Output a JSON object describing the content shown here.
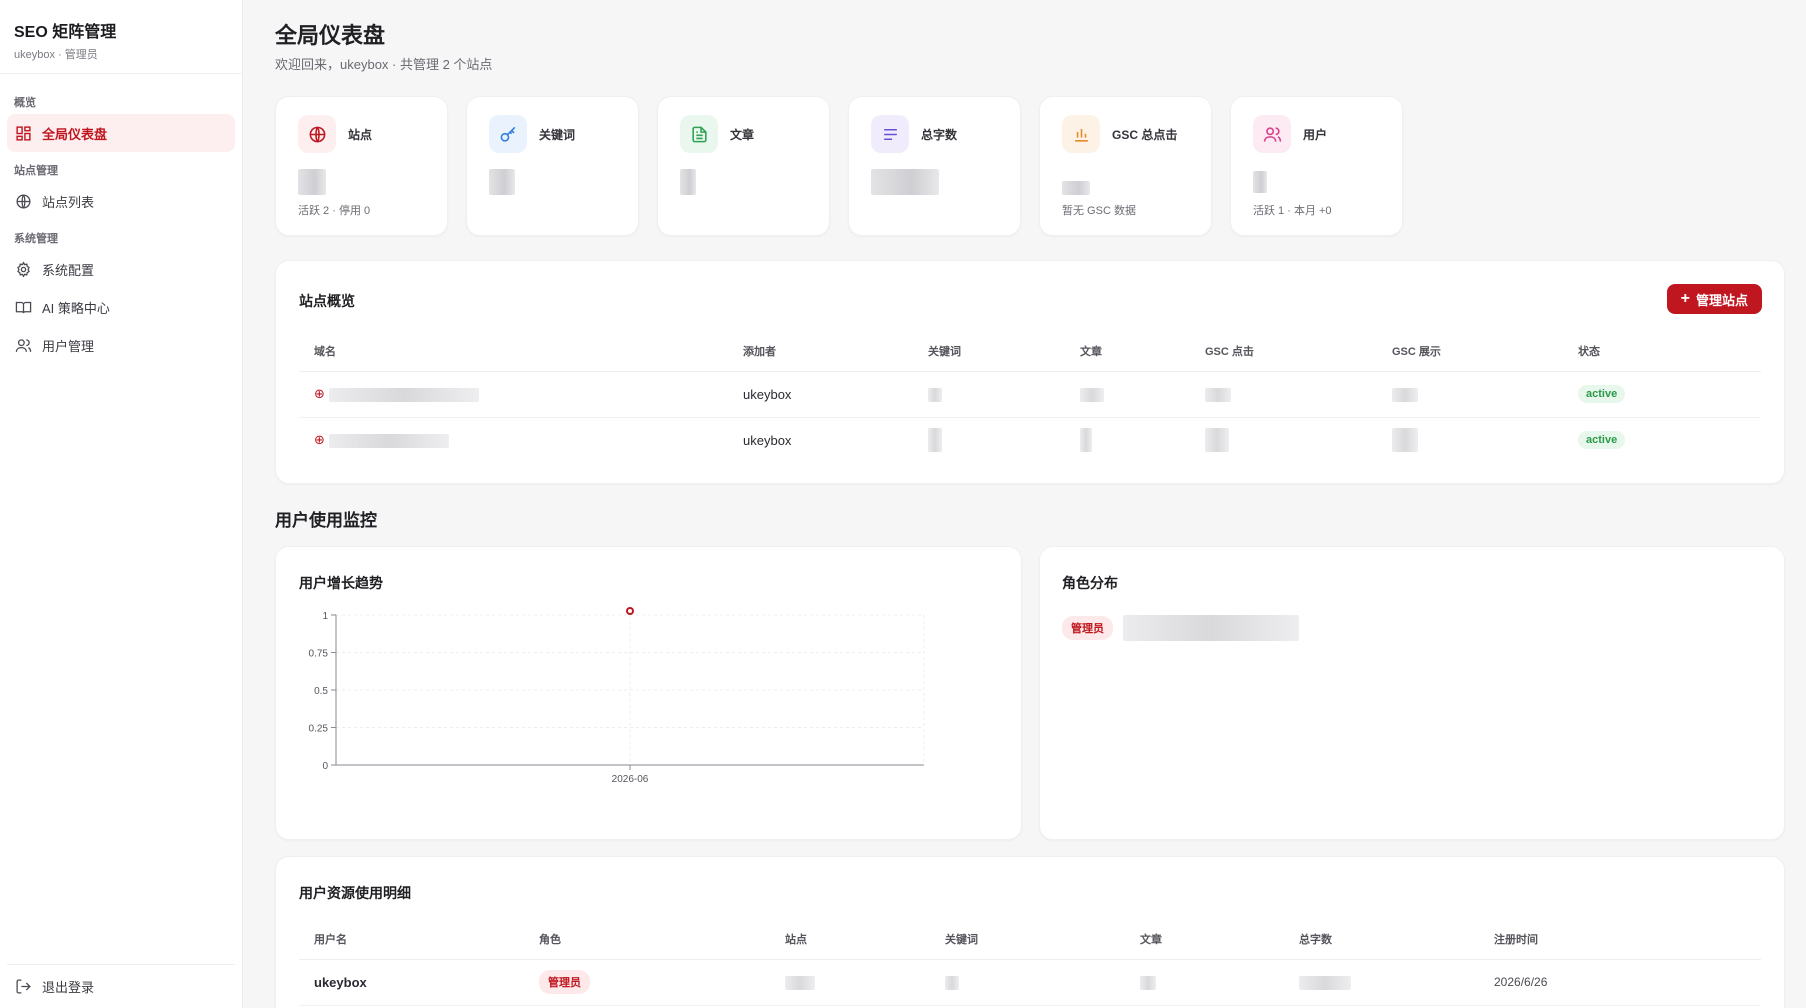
{
  "brand": {
    "title": "SEO 矩阵管理",
    "subtitle": "ukeybox · 管理员"
  },
  "sidebar": {
    "group_overview": "概览",
    "dashboard": "全局仪表盘",
    "group_sites": "站点管理",
    "site_list": "站点列表",
    "group_system": "系统管理",
    "system_config": "系统配置",
    "ai_center": "AI 策略中心",
    "user_mgmt": "用户管理",
    "logout": "退出登录"
  },
  "header": {
    "title": "全局仪表盘",
    "subtitle": "欢迎回来，ukeybox · 共管理 2 个站点"
  },
  "stats": [
    {
      "label": "站点",
      "note": "活跃 2 · 停用 0",
      "icon": "globe-icon",
      "color": "#c0161f"
    },
    {
      "label": "关键词",
      "note": "",
      "icon": "key-icon",
      "color": "#2f7de1"
    },
    {
      "label": "文章",
      "note": "",
      "icon": "document-icon",
      "color": "#2fa353"
    },
    {
      "label": "总字数",
      "note": "",
      "icon": "align-left-icon",
      "color": "#6a4fd6"
    },
    {
      "label": "GSC 总点击",
      "note": "暂无 GSC 数据",
      "icon": "bar-chart-icon",
      "color": "#e58a2b"
    },
    {
      "label": "用户",
      "note": "活跃 1 · 本月 +0",
      "icon": "users-icon",
      "color": "#d8408d"
    }
  ],
  "sites_panel": {
    "title": "站点概览",
    "manage_button": "管理站点",
    "columns": [
      "域名",
      "添加者",
      "关键词",
      "文章",
      "GSC 点击",
      "GSC 展示",
      "状态"
    ],
    "rows": [
      {
        "adder": "ukeybox",
        "status": "active"
      },
      {
        "adder": "ukeybox",
        "status": "active"
      }
    ]
  },
  "monitor_section": {
    "title": "用户使用监控"
  },
  "growth_chart": {
    "title": "用户增长趋势"
  },
  "chart_data": {
    "type": "line",
    "title": "用户增长趋势",
    "x": [
      "2026-06"
    ],
    "series": [
      {
        "values": [
          1
        ]
      }
    ],
    "ylim": [
      0,
      1
    ],
    "yticks": [
      "0",
      "0.25",
      "0.5",
      "0.75",
      "1"
    ],
    "grid": true
  },
  "role_panel": {
    "title": "角色分布",
    "badge": "管理员"
  },
  "usage_panel": {
    "title": "用户资源使用明细",
    "columns": [
      "用户名",
      "角色",
      "站点",
      "关键词",
      "文章",
      "总字数",
      "注册时间"
    ],
    "rows": [
      {
        "username": "ukeybox",
        "role": "管理员",
        "registered": "2026/6/26"
      }
    ]
  }
}
